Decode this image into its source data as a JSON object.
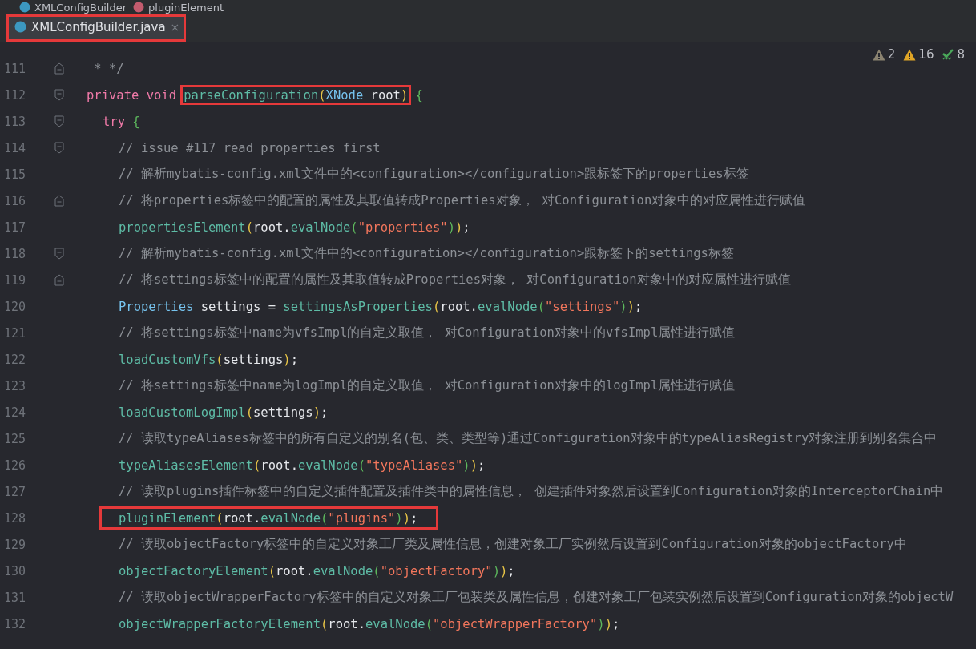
{
  "breadcrumb": [
    {
      "kind": "class",
      "label": "XMLConfigBuilder"
    },
    {
      "kind": "method",
      "label": "pluginElement"
    }
  ],
  "tabs": [
    {
      "label": "XMLConfigBuilder.java",
      "close": "×",
      "selected": true,
      "highlighted": true
    }
  ],
  "inspections": [
    {
      "kind": "weak-warning",
      "count": "2"
    },
    {
      "kind": "warning",
      "count": "16"
    },
    {
      "kind": "typo",
      "count": "8"
    }
  ],
  "lines": [
    {
      "number": "111",
      "kind": "fold-end",
      "tokens": [
        {
          "kind": "comment",
          "text": " * */"
        }
      ]
    },
    {
      "number": "112",
      "kind": "fold-start",
      "tokens": [
        {
          "kind": "keyword",
          "text": "private void"
        },
        {
          "kind": "group",
          "highlighted": true,
          "tokens": [
            {
              "kind": "method",
              "text": "parseConfiguration"
            },
            {
              "kind": "paren1",
              "text": "("
            },
            {
              "kind": "type",
              "text": "XNode"
            },
            {
              "kind": "plain",
              "text": " root"
            },
            {
              "kind": "paren1",
              "text": ")"
            }
          ]
        },
        {
          "kind": "paren2",
          "text": "{"
        }
      ],
      "children": [
        {
          "number": "113",
          "kind": "fold-start",
          "tokens": [
            {
              "kind": "keyword",
              "text": "try"
            },
            {
              "kind": "paren2",
              "text": "{"
            }
          ],
          "children": [
            {
              "number": "114",
              "kind": "fold-start",
              "tokens": [
                {
                  "kind": "comment",
                  "text": "// issue #117 read properties first"
                }
              ]
            },
            {
              "number": "115",
              "kind": "code",
              "tokens": [
                {
                  "kind": "comment",
                  "text": "// 解析mybatis-config.xml文件中的<configuration></configuration>跟标签下的properties标签"
                }
              ]
            },
            {
              "number": "116",
              "kind": "fold-end",
              "tokens": [
                {
                  "kind": "comment",
                  "text": "// 将properties标签中的配置的属性及其取值转成Properties对象， 对Configuration对象中的对应属性进行赋值"
                }
              ]
            },
            {
              "number": "117",
              "kind": "code",
              "tokens": [
                {
                  "kind": "method",
                  "text": "propertiesElement"
                },
                {
                  "kind": "paren1",
                  "text": "("
                },
                {
                  "kind": "plain",
                  "text": "root."
                },
                {
                  "kind": "method",
                  "text": "evalNode"
                },
                {
                  "kind": "paren2",
                  "text": "("
                },
                {
                  "kind": "string",
                  "text": "\"properties\""
                },
                {
                  "kind": "paren2",
                  "text": ")"
                },
                {
                  "kind": "paren1",
                  "text": ")"
                },
                {
                  "kind": "plain",
                  "text": ";"
                }
              ]
            },
            {
              "number": "118",
              "kind": "fold-start",
              "tokens": [
                {
                  "kind": "comment",
                  "text": "// 解析mybatis-config.xml文件中的<configuration></configuration>跟标签下的settings标签"
                }
              ]
            },
            {
              "number": "119",
              "kind": "fold-end",
              "tokens": [
                {
                  "kind": "comment",
                  "text": "// 将settings标签中的配置的属性及其取值转成Properties对象， 对Configuration对象中的对应属性进行赋值"
                }
              ]
            },
            {
              "number": "120",
              "kind": "code",
              "tokens": [
                {
                  "kind": "type",
                  "text": "Properties"
                },
                {
                  "kind": "plain",
                  "text": " settings = "
                },
                {
                  "kind": "method",
                  "text": "settingsAsProperties"
                },
                {
                  "kind": "paren1",
                  "text": "("
                },
                {
                  "kind": "plain",
                  "text": "root."
                },
                {
                  "kind": "method",
                  "text": "evalNode"
                },
                {
                  "kind": "paren2",
                  "text": "("
                },
                {
                  "kind": "string",
                  "text": "\"settings\""
                },
                {
                  "kind": "paren2",
                  "text": ")"
                },
                {
                  "kind": "paren1",
                  "text": ")"
                },
                {
                  "kind": "plain",
                  "text": ";"
                }
              ]
            },
            {
              "number": "121",
              "kind": "code",
              "tokens": [
                {
                  "kind": "comment",
                  "text": "// 将settings标签中name为vfsImpl的自定义取值， 对Configuration对象中的vfsImpl属性进行赋值"
                }
              ]
            },
            {
              "number": "122",
              "kind": "code",
              "tokens": [
                {
                  "kind": "method",
                  "text": "loadCustomVfs"
                },
                {
                  "kind": "paren1",
                  "text": "("
                },
                {
                  "kind": "plain",
                  "text": "settings"
                },
                {
                  "kind": "paren1",
                  "text": ")"
                },
                {
                  "kind": "plain",
                  "text": ";"
                }
              ]
            },
            {
              "number": "123",
              "kind": "code",
              "tokens": [
                {
                  "kind": "comment",
                  "text": "// 将settings标签中name为logImpl的自定义取值， 对Configuration对象中的logImpl属性进行赋值"
                }
              ]
            },
            {
              "number": "124",
              "kind": "code",
              "tokens": [
                {
                  "kind": "method",
                  "text": "loadCustomLogImpl"
                },
                {
                  "kind": "paren1",
                  "text": "("
                },
                {
                  "kind": "plain",
                  "text": "settings"
                },
                {
                  "kind": "paren1",
                  "text": ")"
                },
                {
                  "kind": "plain",
                  "text": ";"
                }
              ]
            },
            {
              "number": "125",
              "kind": "code",
              "tokens": [
                {
                  "kind": "comment",
                  "text": "// 读取typeAliases标签中的所有自定义的别名(包、类、类型等)通过Configuration对象中的typeAliasRegistry对象注册到别名集合中"
                }
              ]
            },
            {
              "number": "126",
              "kind": "code",
              "tokens": [
                {
                  "kind": "method",
                  "text": "typeAliasesElement"
                },
                {
                  "kind": "paren1",
                  "text": "("
                },
                {
                  "kind": "plain",
                  "text": "root."
                },
                {
                  "kind": "method",
                  "text": "evalNode"
                },
                {
                  "kind": "paren2",
                  "text": "("
                },
                {
                  "kind": "string",
                  "text": "\"typeAliases\""
                },
                {
                  "kind": "paren2",
                  "text": ")"
                },
                {
                  "kind": "paren1",
                  "text": ")"
                },
                {
                  "kind": "plain",
                  "text": ";"
                }
              ]
            },
            {
              "number": "127",
              "kind": "code",
              "tokens": [
                {
                  "kind": "comment",
                  "text": "// 读取plugins插件标签中的自定义插件配置及插件类中的属性信息， 创建插件对象然后设置到Configuration对象的InterceptorChain中"
                }
              ]
            },
            {
              "number": "128",
              "kind": "code",
              "tokens": [
                {
                  "kind": "group",
                  "highlighted": true,
                  "tokens": [
                    {
                      "kind": "method",
                      "text": "pluginElement"
                    },
                    {
                      "kind": "paren1",
                      "text": "("
                    },
                    {
                      "kind": "plain",
                      "text": "root."
                    },
                    {
                      "kind": "method",
                      "text": "evalNode"
                    },
                    {
                      "kind": "paren2",
                      "text": "("
                    },
                    {
                      "kind": "string",
                      "text": "\"plugins\""
                    },
                    {
                      "kind": "paren2",
                      "text": ")"
                    },
                    {
                      "kind": "paren1",
                      "text": ")"
                    },
                    {
                      "kind": "plain",
                      "text": ";"
                    }
                  ]
                }
              ]
            },
            {
              "number": "129",
              "kind": "code",
              "tokens": [
                {
                  "kind": "comment",
                  "text": "// 读取objectFactory标签中的自定义对象工厂类及属性信息，创建对象工厂实例然后设置到Configuration对象的objectFactory中"
                }
              ]
            },
            {
              "number": "130",
              "kind": "code",
              "tokens": [
                {
                  "kind": "method",
                  "text": "objectFactoryElement"
                },
                {
                  "kind": "paren1",
                  "text": "("
                },
                {
                  "kind": "plain",
                  "text": "root."
                },
                {
                  "kind": "method",
                  "text": "evalNode"
                },
                {
                  "kind": "paren2",
                  "text": "("
                },
                {
                  "kind": "string",
                  "text": "\"objectFactory\""
                },
                {
                  "kind": "paren2",
                  "text": ")"
                },
                {
                  "kind": "paren1",
                  "text": ")"
                },
                {
                  "kind": "plain",
                  "text": ";"
                }
              ]
            },
            {
              "number": "131",
              "kind": "code",
              "tokens": [
                {
                  "kind": "comment",
                  "text": "// 读取objectWrapperFactory标签中的自定义对象工厂包装类及属性信息，创建对象工厂包装实例然后设置到Configuration对象的objectW"
                }
              ]
            },
            {
              "number": "132",
              "kind": "code",
              "tokens": [
                {
                  "kind": "method",
                  "text": "objectWrapperFactoryElement"
                },
                {
                  "kind": "paren1",
                  "text": "("
                },
                {
                  "kind": "plain",
                  "text": "root."
                },
                {
                  "kind": "method",
                  "text": "evalNode"
                },
                {
                  "kind": "paren2",
                  "text": "("
                },
                {
                  "kind": "string",
                  "text": "\"objectWrapperFactory\""
                },
                {
                  "kind": "paren2",
                  "text": ")"
                },
                {
                  "kind": "paren1",
                  "text": ")"
                },
                {
                  "kind": "plain",
                  "text": ";"
                }
              ]
            }
          ]
        }
      ]
    }
  ]
}
